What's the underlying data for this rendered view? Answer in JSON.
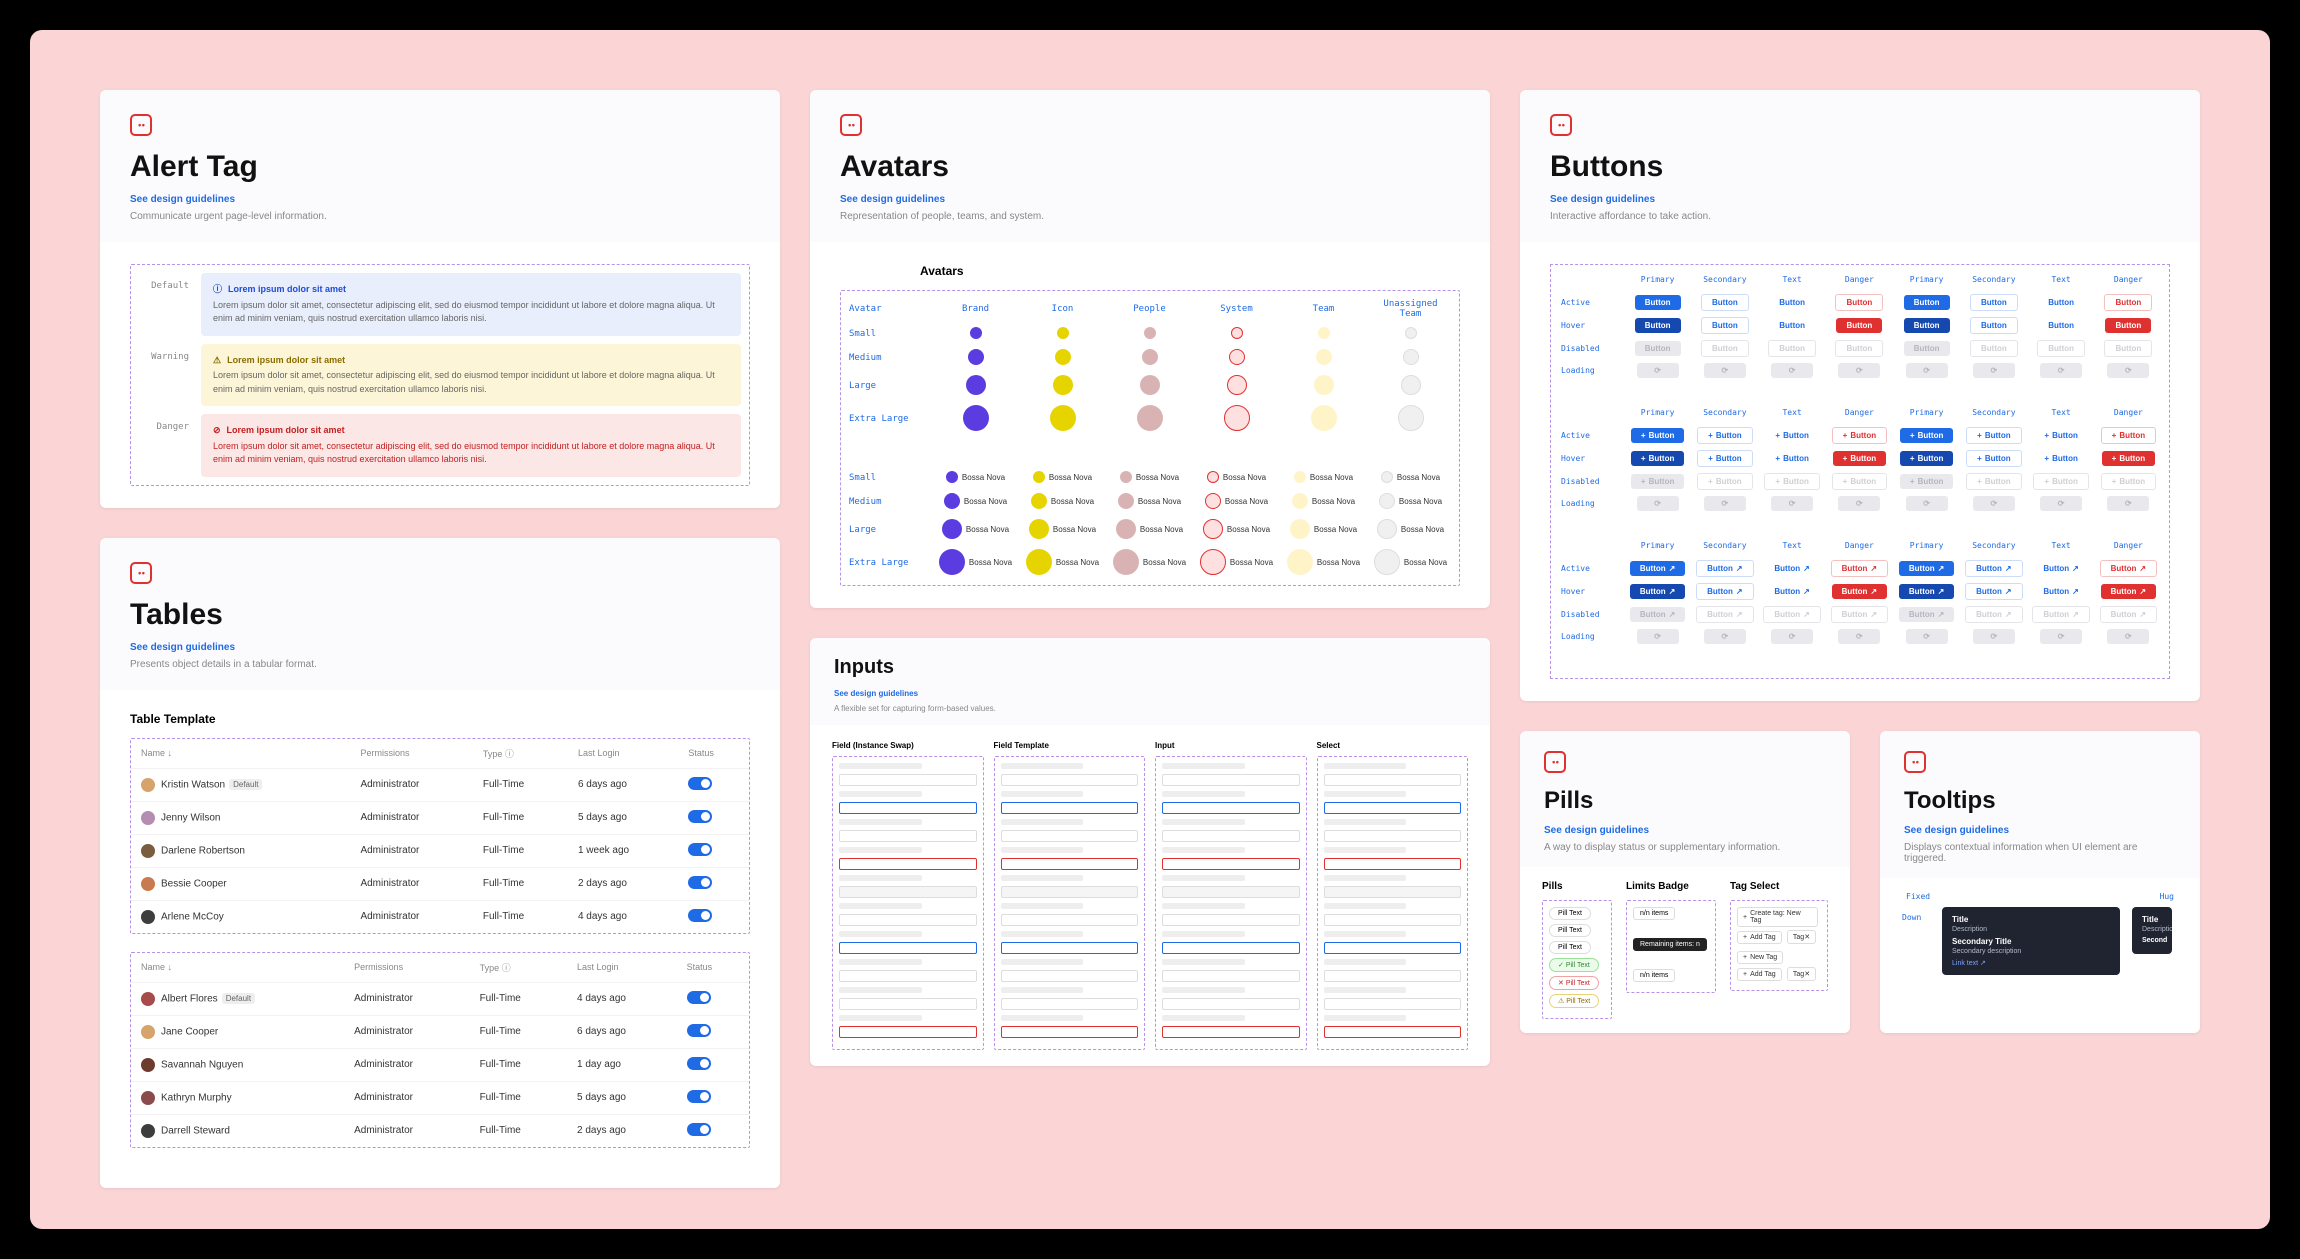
{
  "link_text": "See design guidelines",
  "alert_tag": {
    "title": "Alert Tag",
    "desc": "Communicate urgent page-level information.",
    "rows": [
      {
        "label": "Default",
        "kind": "default",
        "title": "Lorem ipsum dolor sit amet",
        "body": "Lorem ipsum dolor sit amet, consectetur adipiscing elit, sed do eiusmod tempor incididunt ut labore et dolore magna aliqua. Ut enim ad minim veniam, quis nostrud exercitation ullamco laboris nisi."
      },
      {
        "label": "Warning",
        "kind": "warning",
        "title": "Lorem ipsum dolor sit amet",
        "body": "Lorem ipsum dolor sit amet, consectetur adipiscing elit, sed do eiusmod tempor incididunt ut labore et dolore magna aliqua. Ut enim ad minim veniam, quis nostrud exercitation ullamco laboris nisi."
      },
      {
        "label": "Danger",
        "kind": "danger",
        "title": "Lorem ipsum dolor sit amet",
        "body": "Lorem ipsum dolor sit amet, consectetur adipiscing elit, sed do eiusmod tempor incididunt ut labore et dolore magna aliqua. Ut enim ad minim veniam, quis nostrud exercitation ullamco laboris nisi."
      }
    ]
  },
  "tables": {
    "title": "Tables",
    "desc": "Presents object details in a tabular format.",
    "template_heading": "Table Template",
    "headers": [
      "Name ↓",
      "Permissions",
      "Type ⓘ",
      "Last Login",
      "Status"
    ],
    "default_pill": "Default",
    "rows_a": [
      {
        "name": "Kristin Watson",
        "default": true,
        "perm": "Administrator",
        "type": "Full-Time",
        "login": "6 days ago",
        "color": "#d6a36a"
      },
      {
        "name": "Jenny Wilson",
        "perm": "Administrator",
        "type": "Full-Time",
        "login": "5 days ago",
        "color": "#b58db0"
      },
      {
        "name": "Darlene Robertson",
        "perm": "Administrator",
        "type": "Full-Time",
        "login": "1 week ago",
        "color": "#7a5c3e"
      },
      {
        "name": "Bessie Cooper",
        "perm": "Administrator",
        "type": "Full-Time",
        "login": "2 days ago",
        "color": "#c77b4f"
      },
      {
        "name": "Arlene McCoy",
        "perm": "Administrator",
        "type": "Full-Time",
        "login": "4 days ago",
        "color": "#3d3d3d"
      }
    ],
    "rows_b": [
      {
        "name": "Albert Flores",
        "default": true,
        "perm": "Administrator",
        "type": "Full-Time",
        "login": "4 days ago",
        "color": "#a84b4b"
      },
      {
        "name": "Jane Cooper",
        "perm": "Administrator",
        "type": "Full-Time",
        "login": "6 days ago",
        "color": "#d6a36a"
      },
      {
        "name": "Savannah Nguyen",
        "perm": "Administrator",
        "type": "Full-Time",
        "login": "1 day ago",
        "color": "#6c3d2e"
      },
      {
        "name": "Kathryn Murphy",
        "perm": "Administrator",
        "type": "Full-Time",
        "login": "5 days ago",
        "color": "#8a4b4b"
      },
      {
        "name": "Darrell Steward",
        "perm": "Administrator",
        "type": "Full-Time",
        "login": "2 days ago",
        "color": "#3d3d3d"
      }
    ]
  },
  "avatars": {
    "title": "Avatars",
    "desc": "Representation of people, teams, and system.",
    "heading": "Avatars",
    "col_headers": [
      "Avatar",
      "Brand",
      "Icon",
      "People",
      "System",
      "Team",
      "Unassigned Team"
    ],
    "sizes": [
      "Small",
      "Medium",
      "Large",
      "Extra Large"
    ],
    "chip_label": "Bossa Nova"
  },
  "inputs": {
    "title": "Inputs",
    "desc": "A flexible set for capturing form-based values.",
    "cols": [
      "Field (Instance Swap)",
      "Field Template",
      "Input",
      "Select"
    ]
  },
  "buttons": {
    "title": "Buttons",
    "desc": "Interactive affordance to take action.",
    "col_types": [
      "Primary",
      "Secondary",
      "Text",
      "Danger",
      "Primary",
      "Secondary",
      "Text",
      "Danger"
    ],
    "row_states": [
      "Active",
      "Hover",
      "Disabled",
      "Loading"
    ],
    "label": "Button"
  },
  "pills": {
    "title": "Pills",
    "desc": "A way to display status or supplementary information.",
    "pills_col": "Pills",
    "limits_col": "Limits Badge",
    "tag_col": "Tag Select",
    "pill_text": "Pill Text",
    "limits_a": "n/n items",
    "limits_b": "Remaining items: n",
    "limits_c": "n/n items",
    "tag_create": "Create tag: New Tag",
    "tag_new": "New Tag",
    "tag_add": "Add Tag",
    "tag_tag": "Tag"
  },
  "tooltips": {
    "title": "Tooltips",
    "desc": "Displays contextual information when UI element are triggered.",
    "col_fixed": "Fixed",
    "col_hug": "Hug",
    "row_down": "Down",
    "tt_title": "Title",
    "tt_desc": "Description",
    "tt_title2": "Secondary Title",
    "tt_desc2": "Secondary description",
    "tt_link": "Link text ↗"
  }
}
